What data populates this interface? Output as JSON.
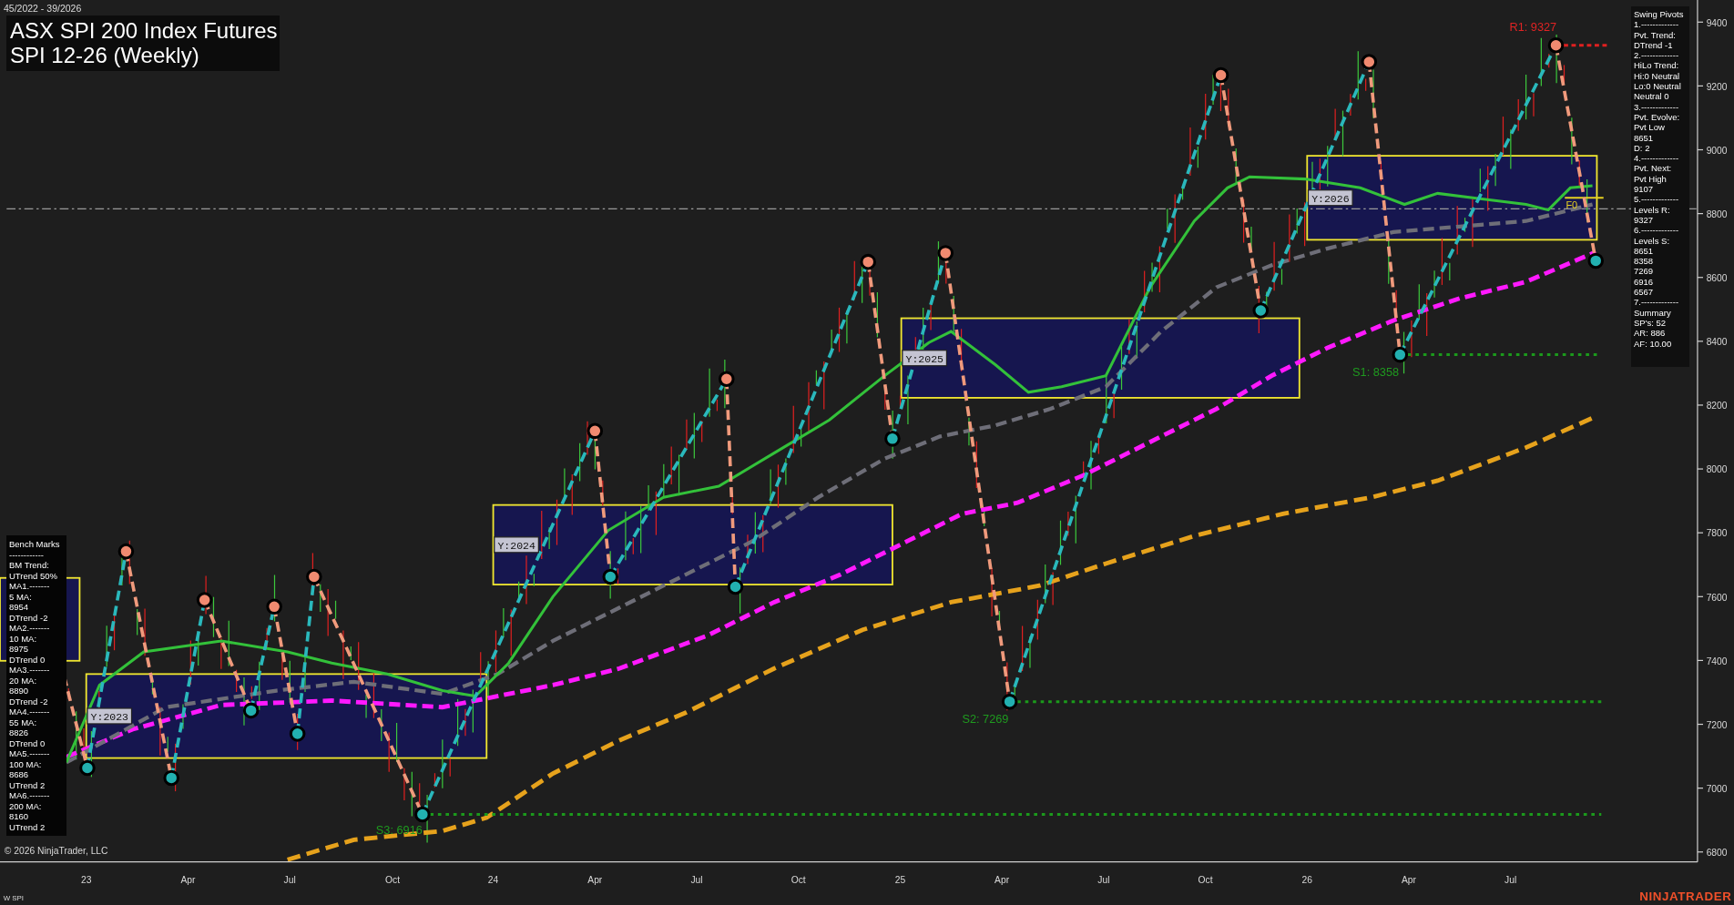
{
  "header": {
    "date_range": "45/2022 - 39/2026",
    "title": "ASX SPI 200 Index Futures",
    "subtitle": "SPI 12-26 (Weekly)"
  },
  "swing_pivots_panel": {
    "lines": [
      "Swing Pivots",
      "1.-------------",
      "Pvt. Trend:",
      "DTrend -1",
      "2.-------------",
      "HiLo Trend:",
      "Hi:0 Neutral",
      "Lo:0 Neutral",
      "Neutral 0",
      "3.-------------",
      "Pvt. Evolve:",
      "Pvt Low",
      "8651",
      "D: 2",
      "4.-------------",
      "Pvt. Next:",
      "Pvt High",
      "9107",
      "5.-------------",
      "Levels R:",
      "9327",
      "6.-------------",
      "Levels S:",
      "8651",
      "8358",
      "7269",
      "6916",
      "6567",
      "7.-------------",
      "Summary",
      "SP's: 52",
      "AR: 886",
      "AF: 10.00"
    ]
  },
  "bench_marks_panel": {
    "lines": [
      "Bench Marks",
      "------------",
      "BM Trend:",
      "UTrend 50%",
      "MA1.-------",
      "5 MA:",
      "8954",
      "DTrend -2",
      "MA2.-------",
      "10 MA:",
      "8975",
      "DTrend 0",
      "MA3.-------",
      "20 MA:",
      "8890",
      "DTrend -2",
      "MA4.-------",
      "55 MA:",
      "8826",
      "DTrend 0",
      "MA5.-------",
      "100 MA:",
      "8686",
      "UTrend 2",
      "MA6.-------",
      "200 MA:",
      "8160",
      "UTrend 2"
    ]
  },
  "chart": {
    "y_axis_labels": [
      "9400",
      "9200",
      "9000",
      "8800",
      "8600",
      "8400",
      "8200",
      "8000",
      "7800",
      "7600",
      "7400",
      "7200",
      "7000",
      "6800"
    ],
    "x_axis_labels": [
      "23",
      "Apr",
      "Jul",
      "Oct",
      "24",
      "Apr",
      "Jul",
      "Oct",
      "25",
      "Apr",
      "Jul",
      "Oct",
      "26",
      "Apr",
      "Jul"
    ],
    "year_labels": [
      "Y:2023",
      "Y:2024",
      "Y:2025",
      "Y:2026"
    ],
    "level_labels": [
      {
        "text": "R1: 9327",
        "kind": "resistance"
      },
      {
        "text": "S1: 8358",
        "kind": "support"
      },
      {
        "text": "S2: 7269",
        "kind": "support"
      },
      {
        "text": "S3: 6916",
        "kind": "support"
      }
    ],
    "fib_label": "F0"
  },
  "footer": {
    "copyright": "© 2026 NinjaTrader, LLC",
    "instrument": "W SPI",
    "logo": "NINJATRADER"
  }
}
